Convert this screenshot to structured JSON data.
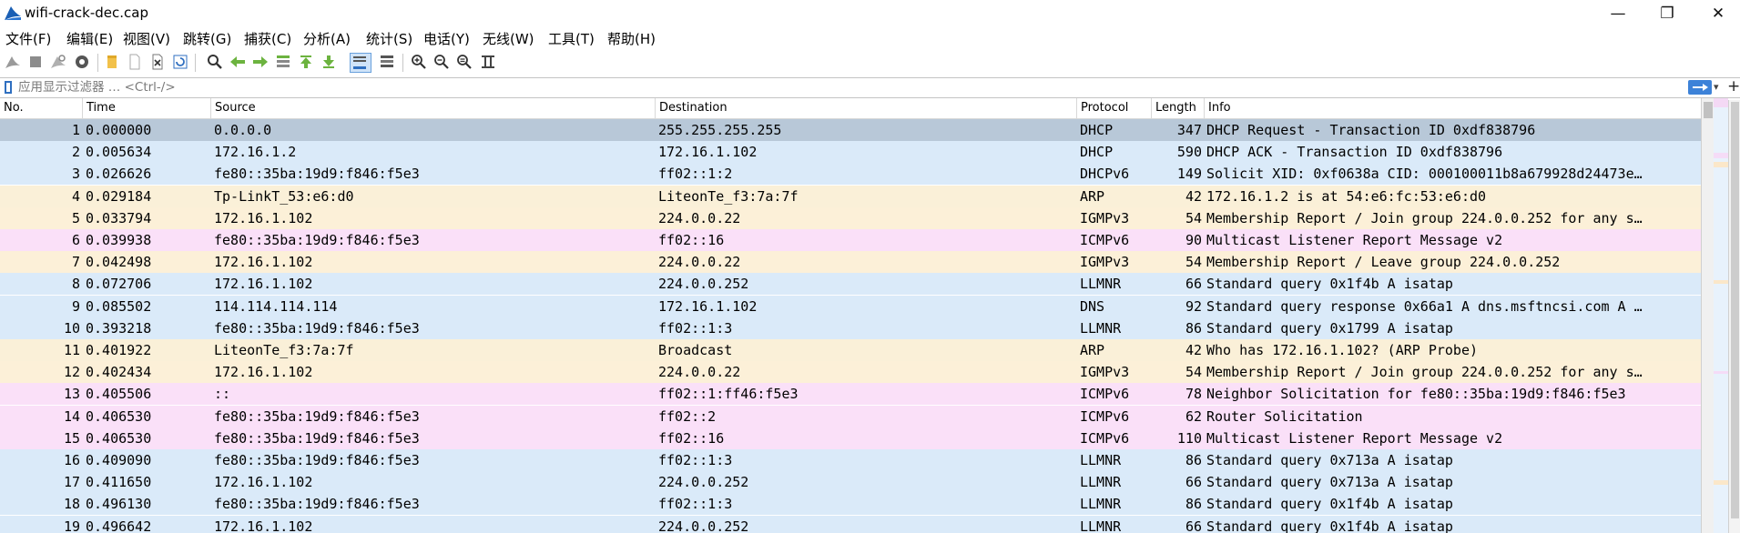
{
  "window": {
    "title": "wifi-crack-dec.cap",
    "controls": {
      "minimize": "—",
      "maximize": "❐",
      "close": "✕"
    }
  },
  "menu": [
    "文件(F)",
    "编辑(E)",
    "视图(V)",
    "跳转(G)",
    "捕获(C)",
    "分析(A)",
    "统计(S)",
    "电话(Y)",
    "无线(W)",
    "工具(T)",
    "帮助(H)"
  ],
  "toolbar": [
    "shark-fin-start-icon",
    "stop-square-icon",
    "restart-fin-icon",
    "capture-options-gear-icon",
    "open-folder-icon",
    "file-icon",
    "close-file-icon",
    "reload-icon",
    "find-magnifier-icon",
    "go-back-arrow-icon",
    "go-forward-arrow-icon",
    "go-to-packet-icon",
    "first-packet-icon",
    "last-packet-icon",
    "autoscroll-icon",
    "colorize-icon",
    "zoom-in-icon",
    "zoom-out-icon",
    "zoom-normal-icon",
    "resize-columns-icon"
  ],
  "filter": {
    "placeholder": "应用显示过滤器 … <Ctrl-/>",
    "value": ""
  },
  "columns": {
    "no": "No.",
    "time": "Time",
    "source": "Source",
    "destination": "Destination",
    "protocol": "Protocol",
    "length": "Length",
    "info": "Info"
  },
  "colors": {
    "dhcp": "#d8e8f8",
    "arp": "#faf0d8",
    "icmpv6": "#fae0f8",
    "igmp": "#fcf0d8",
    "selected": "#b8c8d8"
  },
  "packets": [
    {
      "no": "1",
      "time": "0.000000",
      "source": "0.0.0.0",
      "destination": "255.255.255.255",
      "protocol": "DHCP",
      "length": "347",
      "info": "DHCP Request  - Transaction ID 0xdf838796",
      "color": "#b8c8d8"
    },
    {
      "no": "2",
      "time": "0.005634",
      "source": "172.16.1.2",
      "destination": "172.16.1.102",
      "protocol": "DHCP",
      "length": "590",
      "info": "DHCP ACK      - Transaction ID 0xdf838796",
      "color": "#daeaf9"
    },
    {
      "no": "3",
      "time": "0.026626",
      "source": "fe80::35ba:19d9:f846:f5e3",
      "destination": "ff02::1:2",
      "protocol": "DHCPv6",
      "length": "149",
      "info": "Solicit XID: 0xf0638a CID: 000100011b8a679928d24473e…",
      "color": "#daeaf9"
    },
    {
      "no": "4",
      "time": "0.029184",
      "source": "Tp-LinkT_53:e6:d0",
      "destination": "LiteonTe_f3:7a:7f",
      "protocol": "ARP",
      "length": "42",
      "info": "172.16.1.2 is at 54:e6:fc:53:e6:d0",
      "color": "#faf0d8"
    },
    {
      "no": "5",
      "time": "0.033794",
      "source": "172.16.1.102",
      "destination": "224.0.0.22",
      "protocol": "IGMPv3",
      "length": "54",
      "info": "Membership Report / Join group 224.0.0.252 for any s…",
      "color": "#fcf0d8"
    },
    {
      "no": "6",
      "time": "0.039938",
      "source": "fe80::35ba:19d9:f846:f5e3",
      "destination": "ff02::16",
      "protocol": "ICMPv6",
      "length": "90",
      "info": "Multicast Listener Report Message v2",
      "color": "#fae0f8"
    },
    {
      "no": "7",
      "time": "0.042498",
      "source": "172.16.1.102",
      "destination": "224.0.0.22",
      "protocol": "IGMPv3",
      "length": "54",
      "info": "Membership Report / Leave group 224.0.0.252",
      "color": "#fcf0d8"
    },
    {
      "no": "8",
      "time": "0.072706",
      "source": "172.16.1.102",
      "destination": "224.0.0.252",
      "protocol": "LLMNR",
      "length": "66",
      "info": "Standard query 0x1f4b A isatap",
      "color": "#daeaf9"
    },
    {
      "no": "9",
      "time": "0.085502",
      "source": "114.114.114.114",
      "destination": "172.16.1.102",
      "protocol": "DNS",
      "length": "92",
      "info": "Standard query response 0x66a1 A dns.msftncsi.com A …",
      "color": "#daeaf9"
    },
    {
      "no": "10",
      "time": "0.393218",
      "source": "fe80::35ba:19d9:f846:f5e3",
      "destination": "ff02::1:3",
      "protocol": "LLMNR",
      "length": "86",
      "info": "Standard query 0x1799 A isatap",
      "color": "#daeaf9"
    },
    {
      "no": "11",
      "time": "0.401922",
      "source": "LiteonTe_f3:7a:7f",
      "destination": "Broadcast",
      "protocol": "ARP",
      "length": "42",
      "info": "Who has 172.16.1.102? (ARP Probe)",
      "color": "#faf0d8"
    },
    {
      "no": "12",
      "time": "0.402434",
      "source": "172.16.1.102",
      "destination": "224.0.0.22",
      "protocol": "IGMPv3",
      "length": "54",
      "info": "Membership Report / Join group 224.0.0.252 for any s…",
      "color": "#fcf0d8"
    },
    {
      "no": "13",
      "time": "0.405506",
      "source": "::",
      "destination": "ff02::1:ff46:f5e3",
      "protocol": "ICMPv6",
      "length": "78",
      "info": "Neighbor Solicitation for fe80::35ba:19d9:f846:f5e3",
      "color": "#fae0f8"
    },
    {
      "no": "14",
      "time": "0.406530",
      "source": "fe80::35ba:19d9:f846:f5e3",
      "destination": "ff02::2",
      "protocol": "ICMPv6",
      "length": "62",
      "info": "Router Solicitation",
      "color": "#fae0f8"
    },
    {
      "no": "15",
      "time": "0.406530",
      "source": "fe80::35ba:19d9:f846:f5e3",
      "destination": "ff02::16",
      "protocol": "ICMPv6",
      "length": "110",
      "info": "Multicast Listener Report Message v2",
      "color": "#fae0f8"
    },
    {
      "no": "16",
      "time": "0.409090",
      "source": "fe80::35ba:19d9:f846:f5e3",
      "destination": "ff02::1:3",
      "protocol": "LLMNR",
      "length": "86",
      "info": "Standard query 0x713a A isatap",
      "color": "#daeaf9"
    },
    {
      "no": "17",
      "time": "0.411650",
      "source": "172.16.1.102",
      "destination": "224.0.0.252",
      "protocol": "LLMNR",
      "length": "66",
      "info": "Standard query 0x713a A isatap",
      "color": "#daeaf9"
    },
    {
      "no": "18",
      "time": "0.496130",
      "source": "fe80::35ba:19d9:f846:f5e3",
      "destination": "ff02::1:3",
      "protocol": "LLMNR",
      "length": "86",
      "info": "Standard query 0x1f4b A isatap",
      "color": "#daeaf9"
    },
    {
      "no": "19",
      "time": "0.496642",
      "source": "172.16.1.102",
      "destination": "224.0.0.252",
      "protocol": "LLMNR",
      "length": "66",
      "info": "Standard query 0x1f4b A isatap",
      "color": "#daeaf9"
    }
  ]
}
